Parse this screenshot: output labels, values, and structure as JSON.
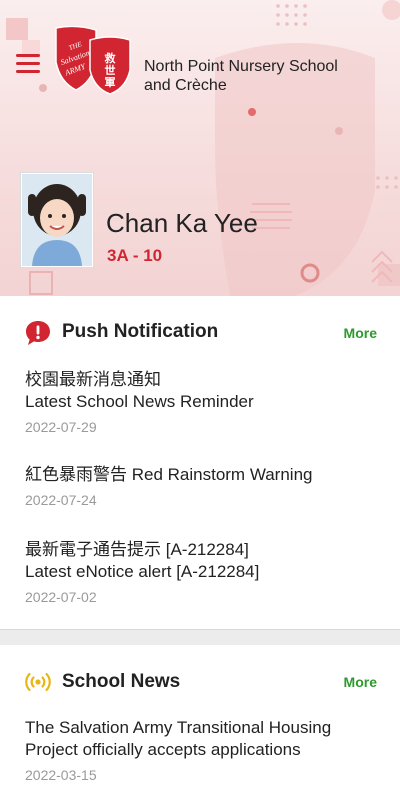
{
  "header": {
    "school_name_line1": "North Point Nursery School",
    "school_name_line2": "and Crèche",
    "menu_icon": "hamburger-menu-icon",
    "logo": {
      "text": "THE SALVATION ARMY",
      "chinese": "救世軍"
    }
  },
  "student": {
    "name": "Chan Ka Yee",
    "class": "3A - 10"
  },
  "push_notification": {
    "title": "Push Notification",
    "icon": "exclamation-bubble-icon",
    "more_label": "More",
    "items": [
      {
        "line1": "校園最新消息通知",
        "line2": "Latest School News Reminder",
        "date": "2022-07-29"
      },
      {
        "line1": "紅色暴雨警告 Red Rainstorm Warning",
        "line2": "",
        "date": "2022-07-24"
      },
      {
        "line1": "最新電子通告提示 [A-212284]",
        "line2": "Latest eNotice alert [A-212284]",
        "date": "2022-07-02"
      }
    ]
  },
  "school_news": {
    "title": "School News",
    "icon": "broadcast-icon",
    "more_label": "More",
    "items": [
      {
        "line1": "The Salvation Army Transitional Housing",
        "line2": "Project officially accepts applications",
        "date": "2022-03-15"
      }
    ]
  },
  "colors": {
    "brand_red": "#d12631",
    "more_green": "#2e9a2e",
    "news_icon_yellow": "#e9b614"
  }
}
